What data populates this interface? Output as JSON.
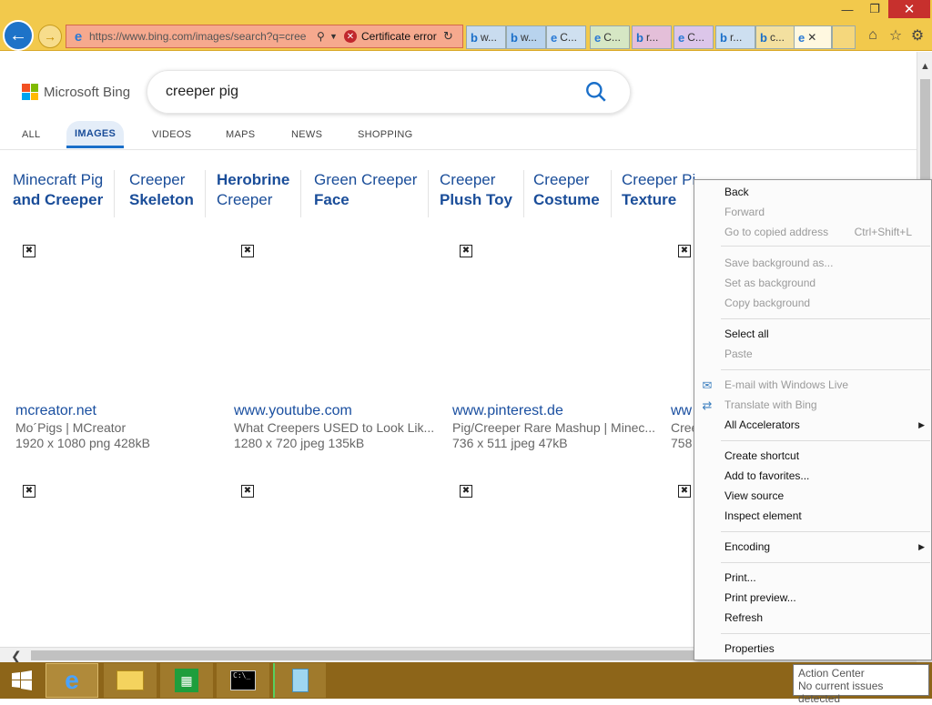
{
  "browser": {
    "url": "https://www.bing.com/images/search?q=cree",
    "cert_error": "Certificate error",
    "tabs": [
      {
        "icon": "b",
        "label": "w..."
      },
      {
        "icon": "b",
        "label": "w..."
      },
      {
        "icon": "e",
        "label": "C..."
      },
      {
        "icon": "e",
        "label": "C..."
      },
      {
        "icon": "b",
        "label": "r..."
      },
      {
        "icon": "e",
        "label": "C..."
      },
      {
        "icon": "b",
        "label": "r..."
      },
      {
        "icon": "b",
        "label": "c..."
      }
    ],
    "active_tab_close": "✕",
    "colors": {
      "chrome": "#f2c94c",
      "address_error": "#f6a98e",
      "close": "#c7302d"
    }
  },
  "bing": {
    "logo_text": "Microsoft Bing",
    "query": "creeper pig",
    "nav": [
      "ALL",
      "IMAGES",
      "VIDEOS",
      "MAPS",
      "NEWS",
      "SHOPPING"
    ],
    "related": [
      {
        "line1": "Minecraft Pig",
        "line2": "and Creeper"
      },
      {
        "line1": "Creeper",
        "line2": "Skeleton"
      },
      {
        "line1": "Herobrine",
        "line2": "Creeper"
      },
      {
        "line1": "Green Creeper",
        "line2": "Face"
      },
      {
        "line1": "Creeper",
        "line2": "Plush Toy"
      },
      {
        "line1": "Creeper",
        "line2": "Costume"
      },
      {
        "line1": "Creeper Pi",
        "line2": "Texture"
      }
    ],
    "results": [
      {
        "site": "mcreator.net",
        "title": "Mo´Pigs | MCreator",
        "meta": "1920 x 1080 png 428kB"
      },
      {
        "site": "www.youtube.com",
        "title": "What Creepers USED to Look Lik...",
        "meta": "1280 x 720 jpeg 135kB"
      },
      {
        "site": "www.pinterest.de",
        "title": "Pig/Creeper Rare Mashup | Minec...",
        "meta": "736 x 511 jpeg 47kB"
      },
      {
        "site": "ww",
        "title": "Cree",
        "meta": "758"
      }
    ]
  },
  "context_menu": {
    "back": "Back",
    "forward": "Forward",
    "go_copied": "Go to copied address",
    "go_copied_shortcut": "Ctrl+Shift+L",
    "save_bg": "Save background as...",
    "set_bg": "Set as background",
    "copy_bg": "Copy background",
    "select_all": "Select all",
    "paste": "Paste",
    "email_live": "E-mail with Windows Live",
    "translate": "Translate with Bing",
    "accelerators": "All Accelerators",
    "create_shortcut": "Create shortcut",
    "add_fav": "Add to favorites...",
    "view_source": "View source",
    "inspect": "Inspect element",
    "encoding": "Encoding",
    "print": "Print...",
    "print_preview": "Print preview...",
    "refresh": "Refresh",
    "properties": "Properties"
  },
  "tooltip": {
    "title": "Action Center",
    "body": "No current issues detected"
  }
}
